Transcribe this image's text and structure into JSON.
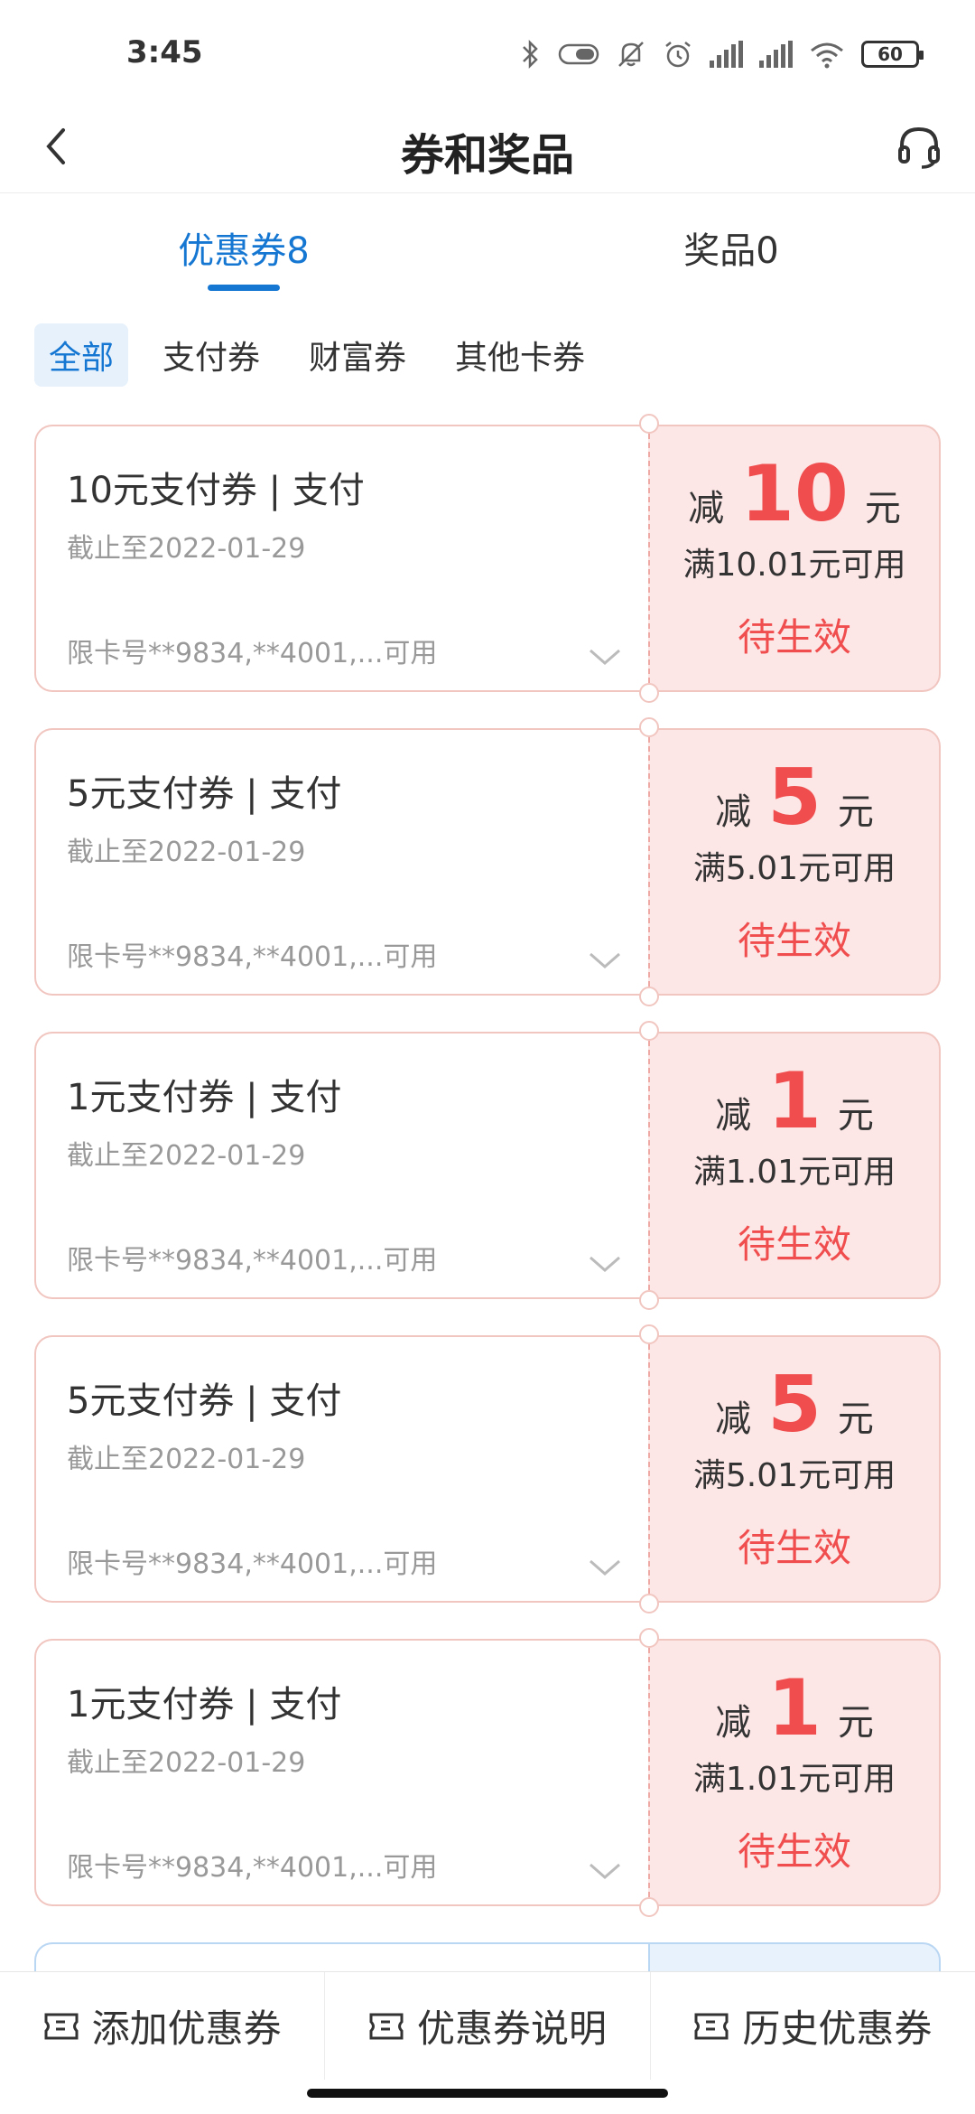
{
  "status_bar": {
    "time": "3:45",
    "battery": "60"
  },
  "nav": {
    "title": "券和奖品"
  },
  "tabs": {
    "coupons": "优惠券8",
    "prizes": "奖品0"
  },
  "filters": [
    "全部",
    "支付券",
    "财富券",
    "其他卡券"
  ],
  "coupons": [
    {
      "name": "10元支付券  | 支付",
      "expiry": "截止至2022-01-29",
      "cards": "限卡号**9834,**4001,...可用",
      "discount_label": "减",
      "amount": "10",
      "unit": "元",
      "threshold": "满10.01元可用",
      "status": "待生效"
    },
    {
      "name": "5元支付券  | 支付",
      "expiry": "截止至2022-01-29",
      "cards": "限卡号**9834,**4001,...可用",
      "discount_label": "减",
      "amount": "5",
      "unit": "元",
      "threshold": "满5.01元可用",
      "status": "待生效"
    },
    {
      "name": "1元支付券  | 支付",
      "expiry": "截止至2022-01-29",
      "cards": "限卡号**9834,**4001,...可用",
      "discount_label": "减",
      "amount": "1",
      "unit": "元",
      "threshold": "满1.01元可用",
      "status": "待生效"
    },
    {
      "name": "5元支付券  | 支付",
      "expiry": "截止至2022-01-29",
      "cards": "限卡号**9834,**4001,...可用",
      "discount_label": "减",
      "amount": "5",
      "unit": "元",
      "threshold": "满5.01元可用",
      "status": "待生效"
    },
    {
      "name": "1元支付券  | 支付",
      "expiry": "截止至2022-01-29",
      "cards": "限卡号**9834,**4001,...可用",
      "discount_label": "减",
      "amount": "1",
      "unit": "元",
      "threshold": "满1.01元可用",
      "status": "待生效"
    }
  ],
  "bottom_bar": {
    "add": "添加优惠券",
    "info": "优惠券说明",
    "history": "历史优惠券"
  },
  "colors": {
    "accent": "#1677d2",
    "red": "#f04e4e",
    "coupon_bg": "#fde6e6"
  }
}
